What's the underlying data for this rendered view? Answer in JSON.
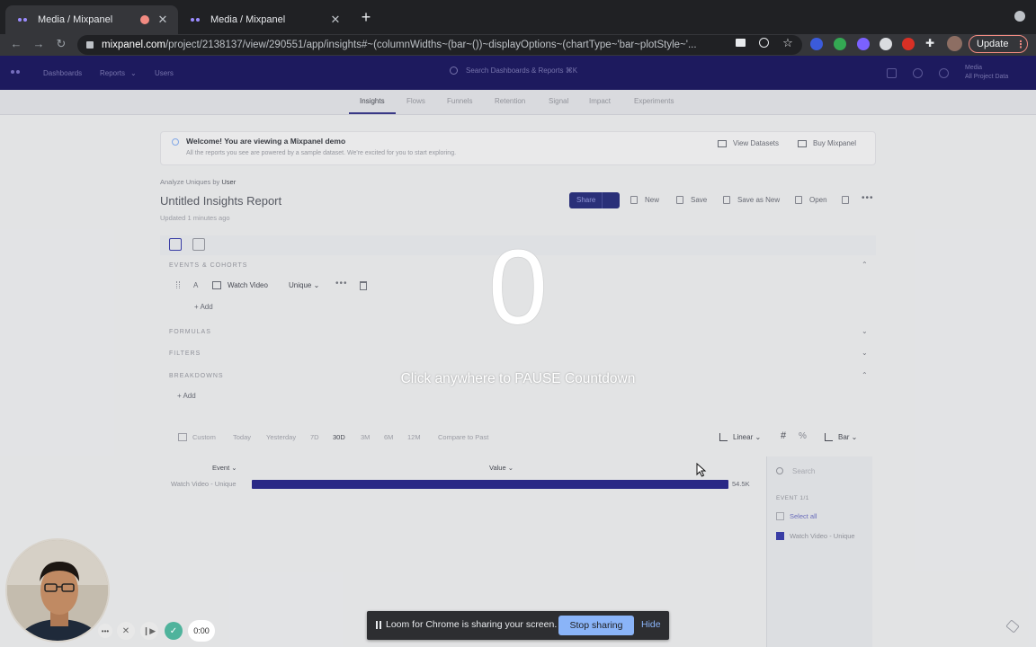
{
  "browser": {
    "tabs": [
      {
        "title": "Media / Mixpanel"
      },
      {
        "title": "Media / Mixpanel"
      }
    ],
    "url_host": "mixpanel.com",
    "url_path": "/project/2138137/view/290551/app/insights#~(columnWidths~(bar~())~displayOptions~(chartType~'bar~plotStyle~'...",
    "update_label": "Update"
  },
  "app": {
    "nav": {
      "dashboards": "Dashboards",
      "reports": "Reports",
      "users": "Users"
    },
    "search_placeholder": "Search Dashboards & Reports ⌘K",
    "project": {
      "name": "Media",
      "sub": "All Project Data"
    },
    "subnav": [
      "Insights",
      "Flows",
      "Funnels",
      "Retention",
      "Signal",
      "Impact",
      "Experiments"
    ],
    "banner": {
      "title": "Welcome! You are viewing a Mixpanel demo",
      "text": "All the reports you see are powered by a sample dataset. We're excited for you to start exploring.",
      "view_datasets": "View Datasets",
      "buy": "Buy Mixpanel"
    },
    "analyze_prefix": "Analyze Uniques by",
    "analyze_value": "User",
    "report_title": "Untitled Insights Report",
    "updated": "Updated 1 minutes ago",
    "actions": {
      "share": "Share",
      "new": "New",
      "save": "Save",
      "save_as_new": "Save as New",
      "open": "Open"
    },
    "sections": {
      "events": "EVENTS & COHORTS",
      "formulas": "FORMULAS",
      "filters": "FILTERS",
      "breakdowns": "BREAKDOWNS"
    },
    "event_row": {
      "letter": "A",
      "name": "Watch Video",
      "measure": "Unique"
    },
    "add_label": "Add",
    "controls": {
      "custom": "Custom",
      "today": "Today",
      "yesterday": "Yesterday",
      "d7": "7D",
      "d30": "30D",
      "m3": "3M",
      "m6": "6M",
      "m12": "12M",
      "compare": "Compare to Past",
      "scale": "Linear",
      "chart_type": "Bar"
    },
    "table": {
      "col_event": "Event",
      "col_value": "Value"
    },
    "sidebar": {
      "search_placeholder": "Search",
      "events_header": "EVENT 1/1",
      "select_all": "Select all",
      "item": "Watch Video - Unique"
    }
  },
  "chart_data": {
    "type": "bar",
    "categories": [
      "Watch Video - Unique"
    ],
    "values": [
      54500
    ],
    "value_labels": [
      "54.5K"
    ],
    "orientation": "horizontal"
  },
  "overlay": {
    "countdown": "0",
    "hint": "Click anywhere to PAUSE Countdown"
  },
  "loom": {
    "time": "0:00",
    "share_message": "Loom for Chrome is sharing your screen.",
    "stop_sharing": "Stop sharing",
    "hide": "Hide"
  },
  "colors": {
    "accent": "#2b2a8f",
    "header": "#1d1a63",
    "stop_btn": "#8ab4f8"
  }
}
